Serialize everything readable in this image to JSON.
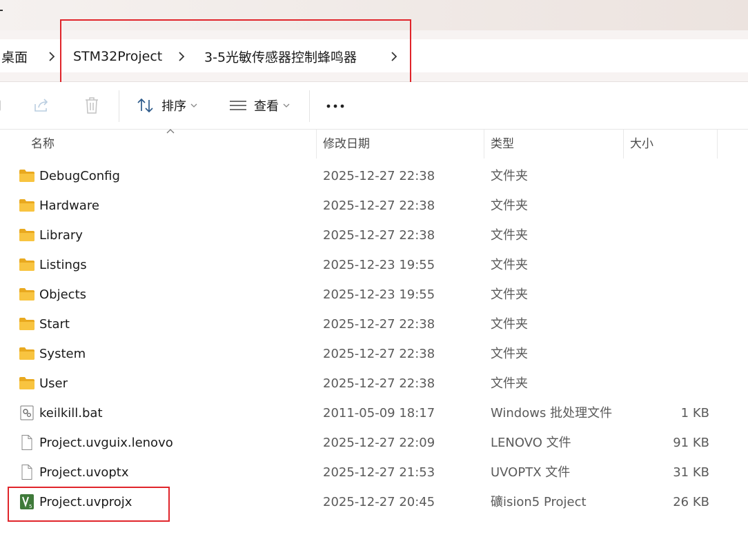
{
  "breadcrumb": {
    "items": [
      "桌面",
      "STM32Project",
      "3-5光敏传感器控制蜂鸣器"
    ]
  },
  "toolbar": {
    "sort_label": "排序",
    "view_label": "查看",
    "more_label": "•••"
  },
  "columns": {
    "name": "名称",
    "date": "修改日期",
    "type": "类型",
    "size": "大小"
  },
  "files": [
    {
      "name": "DebugConfig",
      "date": "2025-12-27 22:38",
      "type": "文件夹",
      "size": "",
      "icon": "folder-icon"
    },
    {
      "name": "Hardware",
      "date": "2025-12-27 22:38",
      "type": "文件夹",
      "size": "",
      "icon": "folder-icon"
    },
    {
      "name": "Library",
      "date": "2025-12-27 22:38",
      "type": "文件夹",
      "size": "",
      "icon": "folder-icon"
    },
    {
      "name": "Listings",
      "date": "2025-12-23 19:55",
      "type": "文件夹",
      "size": "",
      "icon": "folder-icon"
    },
    {
      "name": "Objects",
      "date": "2025-12-23 19:55",
      "type": "文件夹",
      "size": "",
      "icon": "folder-icon"
    },
    {
      "name": "Start",
      "date": "2025-12-27 22:38",
      "type": "文件夹",
      "size": "",
      "icon": "folder-icon"
    },
    {
      "name": "System",
      "date": "2025-12-27 22:38",
      "type": "文件夹",
      "size": "",
      "icon": "folder-icon"
    },
    {
      "name": "User",
      "date": "2025-12-27 22:38",
      "type": "文件夹",
      "size": "",
      "icon": "folder-icon"
    },
    {
      "name": "keilkill.bat",
      "date": "2011-05-09 18:17",
      "type": "Windows 批处理文件",
      "size": "1 KB",
      "icon": "batch-file-icon"
    },
    {
      "name": "Project.uvguix.lenovo",
      "date": "2025-12-27 22:09",
      "type": "LENOVO 文件",
      "size": "91 KB",
      "icon": "file-icon"
    },
    {
      "name": "Project.uvoptx",
      "date": "2025-12-27 21:53",
      "type": "UVOPTX 文件",
      "size": "31 KB",
      "icon": "file-icon"
    },
    {
      "name": "Project.uvprojx",
      "date": "2025-12-27 20:45",
      "type": "礦ision5 Project",
      "size": "26 KB",
      "icon": "keil-project-icon"
    }
  ],
  "colors": {
    "folder": "#f8c440",
    "highlight_box": "#e0242a",
    "keil_green": "#3f7a3a"
  }
}
